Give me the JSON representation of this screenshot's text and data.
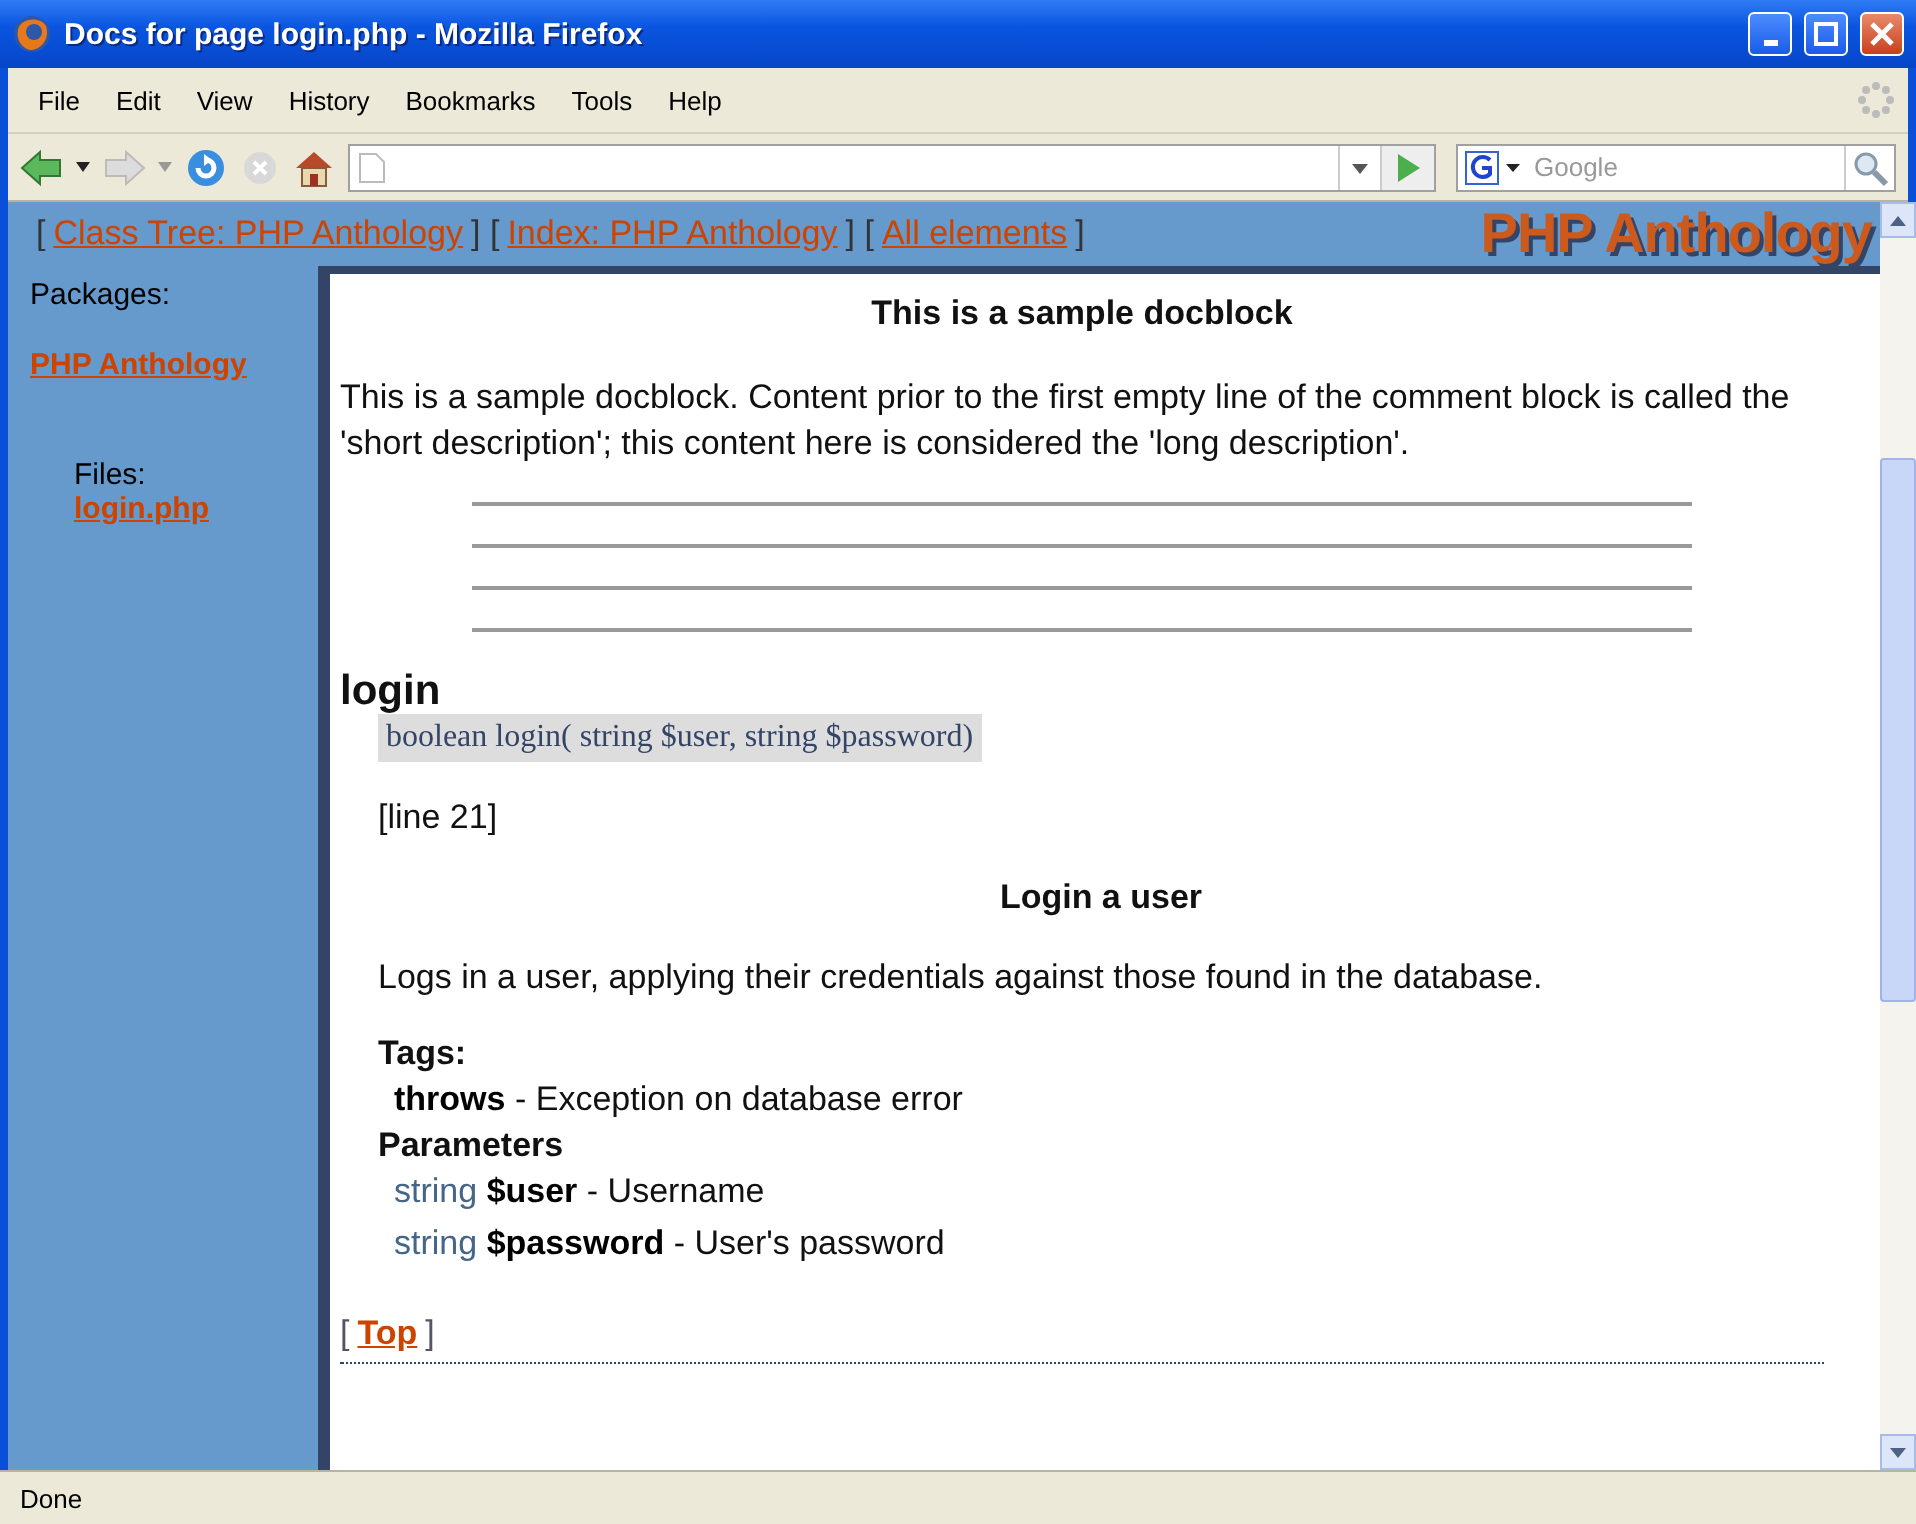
{
  "window": {
    "title": "Docs for page login.php - Mozilla Firefox"
  },
  "menu": [
    "File",
    "Edit",
    "View",
    "History",
    "Bookmarks",
    "Tools",
    "Help"
  ],
  "toolbar": {
    "search": {
      "placeholder": "Google"
    }
  },
  "nav": [
    {
      "open": "[",
      "label": "Class Tree: PHP Anthology",
      "close": "]"
    },
    {
      "open": "[",
      "label": "Index: PHP Anthology",
      "close": "]"
    },
    {
      "open": "[",
      "label": "All elements",
      "close": "]"
    }
  ],
  "logo": "PHP Anthology",
  "sidebar": {
    "packages_label": "Packages:",
    "package": "PHP Anthology",
    "files_label": "Files:",
    "files": [
      "login.php"
    ]
  },
  "docblock": {
    "title": "This is a sample docblock",
    "text": "This is a sample docblock. Content prior to the first empty line of the comment block is called the 'short description'; this content here is considered the 'long description'."
  },
  "function": {
    "name": "login",
    "signature": "boolean login( string $user, string $password)",
    "line": "[line 21]",
    "summary": "Login a user",
    "description": "Logs in a user, applying their credentials against those found in the database.",
    "tags_label": "Tags:",
    "tags": [
      {
        "name": "throws",
        "text": "- Exception on database error"
      }
    ],
    "parameters_label": "Parameters",
    "parameters": [
      {
        "type": "string",
        "name": "$user",
        "text": "- Username"
      },
      {
        "type": "string",
        "name": "$password",
        "text": "- User's password"
      }
    ]
  },
  "top_link": {
    "open": "[",
    "label": "Top",
    "close": "]"
  },
  "status_bar": "Done"
}
